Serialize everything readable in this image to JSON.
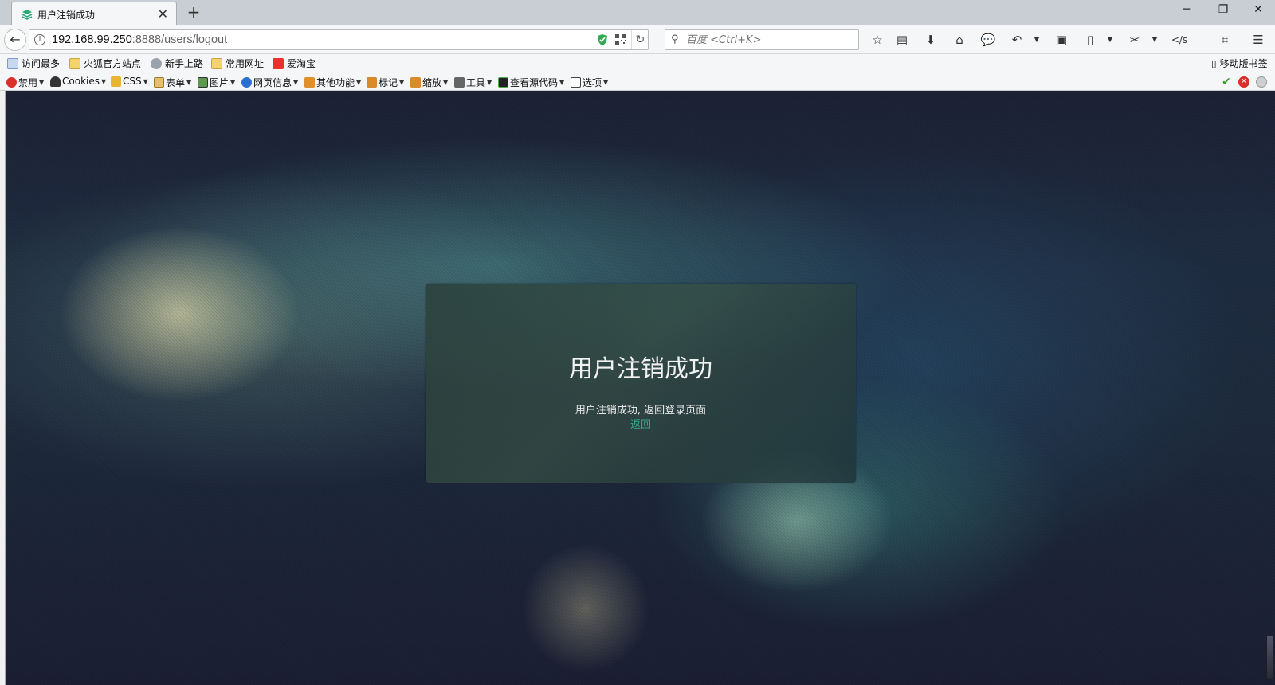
{
  "tab": {
    "title": "用户注销成功",
    "close_glyph": "✕"
  },
  "window": {
    "new_tab_glyph": "+",
    "minimize_glyph": "─",
    "restore_glyph": "❐",
    "close_glyph": "✕"
  },
  "navbar": {
    "back_glyph": "←",
    "url_host": "192.168.99.250",
    "url_rest": ":8888/users/logout",
    "search_placeholder": "百度 <Ctrl+K>",
    "toolbar_icons": [
      "bookmark-star-icon",
      "reading-list-icon",
      "download-icon",
      "home-icon",
      "chat-icon",
      "undo-icon",
      "reader-view-icon",
      "pdf-icon",
      "screenshot-icon",
      "js-icon",
      "crop-icon",
      "menu-icon"
    ],
    "js_label": "</s"
  },
  "bookmarks": {
    "items": [
      "访问最多",
      "火狐官方站点",
      "新手上路",
      "常用网址",
      "爱淘宝"
    ],
    "mobile": "移动版书签"
  },
  "devbar": {
    "items": [
      "禁用",
      "Cookies",
      "CSS",
      "表单",
      "图片",
      "网页信息",
      "其他功能",
      "标记",
      "缩放",
      "工具",
      "查看源代码",
      "选项"
    ]
  },
  "page": {
    "heading": "用户注销成功",
    "message": "用户注销成功, 返回登录页面",
    "back_link": "返回"
  },
  "colors": {
    "link": "#3aa58a",
    "card_bg": "#2e463f",
    "page_bg": "#1e2438"
  }
}
